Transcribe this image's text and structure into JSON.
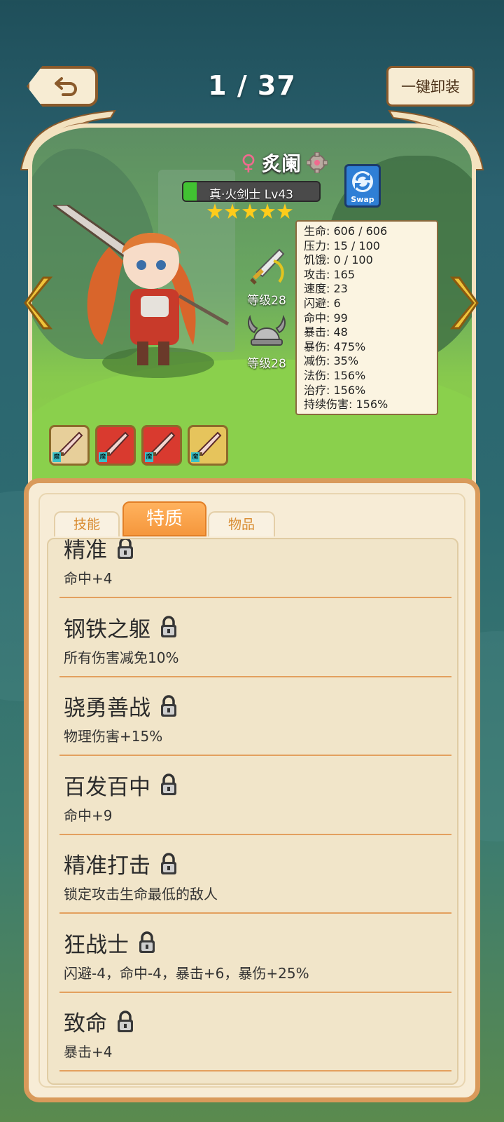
{
  "header": {
    "counter": "1 / 37",
    "unequip_label": "一键卸装"
  },
  "hero": {
    "gender_symbol": "♀",
    "name": "炙阑",
    "class_level": "真·火剑士 Lv43",
    "health_fraction": 0.1,
    "stars": 5,
    "swap_label": "Swap"
  },
  "equipment": [
    {
      "name": "sword",
      "level_label": "等级28"
    },
    {
      "name": "helmet",
      "level_label": "等级28"
    }
  ],
  "stats": [
    "生命: 606 / 606",
    "压力: 15 / 100",
    "饥饿: 0 / 100",
    "攻击: 165",
    "速度: 23",
    "闪避: 6",
    "命中: 99",
    "暴击: 48",
    "暴伤: 475%",
    "减伤: 35%",
    "法伤: 156%",
    "治疗: 156%",
    "持续伤害: 156%"
  ],
  "items": [
    {
      "name": "magic-sword",
      "tag": "魔",
      "color": "#e7cf9a"
    },
    {
      "name": "red-blade",
      "tag": "魔",
      "color": "#d93a2f"
    },
    {
      "name": "red-armor",
      "tag": "魔",
      "color": "#d93a2f"
    },
    {
      "name": "green-axe",
      "tag": "魔",
      "color": "#e6c45c"
    }
  ],
  "tabs": {
    "skills": "技能",
    "traits": "特质",
    "items": "物品",
    "active": "traits"
  },
  "traits": [
    {
      "title": "精准",
      "desc": "命中+4"
    },
    {
      "title": "钢铁之躯",
      "desc": "所有伤害减免10%"
    },
    {
      "title": "骁勇善战",
      "desc": "物理伤害+15%"
    },
    {
      "title": "百发百中",
      "desc": "命中+9"
    },
    {
      "title": "精准打击",
      "desc": "锁定攻击生命最低的敌人"
    },
    {
      "title": "狂战士",
      "desc": "闪避-4，命中-4，暴击+6，暴伤+25%"
    },
    {
      "title": "致命",
      "desc": "暴击+4"
    }
  ]
}
